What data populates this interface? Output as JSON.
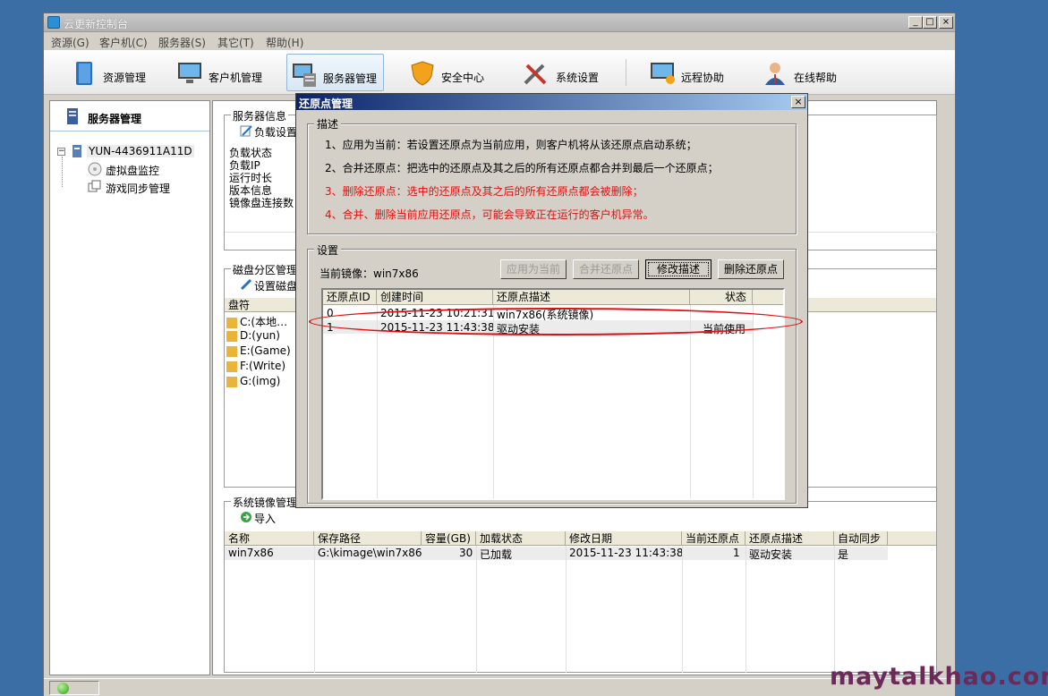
{
  "window": {
    "title": "云更新控制台"
  },
  "menu": [
    "资源(G)",
    "客户机(C)",
    "服务器(S)",
    "其它(T)",
    "帮助(H)"
  ],
  "toolbar": [
    {
      "label": "资源管理",
      "icon": "book-icon"
    },
    {
      "label": "客户机管理",
      "icon": "monitor-icon"
    },
    {
      "label": "服务器管理",
      "icon": "server-icon"
    },
    {
      "label": "安全中心",
      "icon": "shield-icon"
    },
    {
      "label": "系统设置",
      "icon": "tools-icon"
    },
    {
      "label": "远程协助",
      "icon": "remote-monitor-icon"
    },
    {
      "label": "在线帮助",
      "icon": "support-person-icon"
    }
  ],
  "sidebar": {
    "title": "服务器管理",
    "server": "YUN-4436911A11D",
    "items": [
      "虚拟盘监控",
      "游戏同步管理"
    ]
  },
  "server_info": {
    "legend": "服务器信息",
    "button": "负载设置",
    "labels": [
      "负载状态",
      "负载IP",
      "运行时长",
      "版本信息",
      "镜像盘连接数"
    ]
  },
  "disk": {
    "legend": "磁盘分区管理",
    "button": "设置磁盘",
    "header": "盘符",
    "items": [
      "C:(本地…",
      "D:(yun)",
      "E:(Game)",
      "F:(Write)",
      "G:(img)"
    ]
  },
  "images": {
    "legend": "系统镜像管理",
    "import": "导入",
    "headers": [
      "名称",
      "保存路径",
      "容量(GB)",
      "加载状态",
      "修改日期",
      "当前还原点",
      "还原点描述",
      "自动同步"
    ],
    "rows": [
      [
        "win7x86",
        "G:\\kimage\\win7x86",
        "30",
        "已加载",
        "2015-11-23 11:43:38",
        "1",
        "驱动安装",
        "是"
      ]
    ]
  },
  "dialog": {
    "title": "还原点管理",
    "desc_legend": "描述",
    "desc": [
      "1、应用为当前：若设置还原点为当前应用，则客户机将从该还原点启动系统；",
      "2、合并还原点：把选中的还原点及其之后的所有还原点都合并到最后一个还原点；",
      "3、删除还原点：选中的还原点及其之后的所有还原点都会被删除；",
      "4、合并、删除当前应用还原点，可能会导致正在运行的客户机异常。"
    ],
    "settings_legend": "设置",
    "current_image_label": "当前镜像：win7x86",
    "buttons": [
      "应用为当前",
      "合并还原点",
      "修改描述",
      "删除还原点"
    ],
    "headers": [
      "还原点ID",
      "创建时间",
      "还原点描述",
      "状态"
    ],
    "rows": [
      [
        "0",
        "2015-11-23 10:21:31",
        "win7x86(系统镜像)",
        ""
      ],
      [
        "1",
        "2015-11-23 11:43:38",
        "驱动安装",
        "当前使用"
      ]
    ]
  },
  "watermark": "maytalkhao.com",
  "colors": {
    "dialog_title": "#0a246a",
    "warning_text": "#e01010",
    "annotation": "#e01010"
  }
}
